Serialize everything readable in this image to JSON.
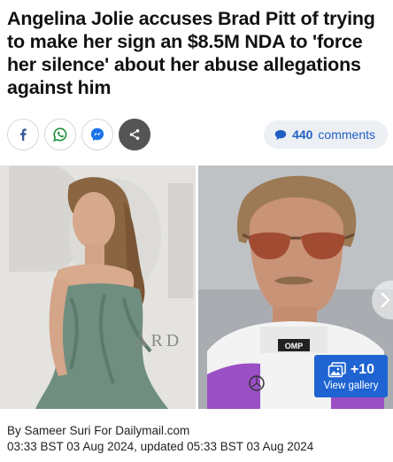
{
  "article": {
    "headline": "Angelina Jolie accuses Brad Pitt of trying to make her sign an $8.5M NDA to 'force her silence' about her abuse allegations against him"
  },
  "share": {
    "buttons": [
      {
        "icon": "facebook-icon"
      },
      {
        "icon": "whatsapp-icon"
      },
      {
        "icon": "messenger-icon"
      },
      {
        "icon": "share-icon"
      }
    ],
    "comments_count": "440",
    "comments_label": "comments",
    "accent_color": "#1f5fc4"
  },
  "gallery": {
    "count": "+10",
    "label": "View gallery",
    "color": "#1f64d2",
    "backdrop_left": "ARD"
  },
  "byline": {
    "prefix": "By ",
    "author": "Sameer Suri For Dailymail.com",
    "timestamp": "03:33 BST 03 Aug 2024, updated 05:33 BST 03 Aug 2024"
  }
}
